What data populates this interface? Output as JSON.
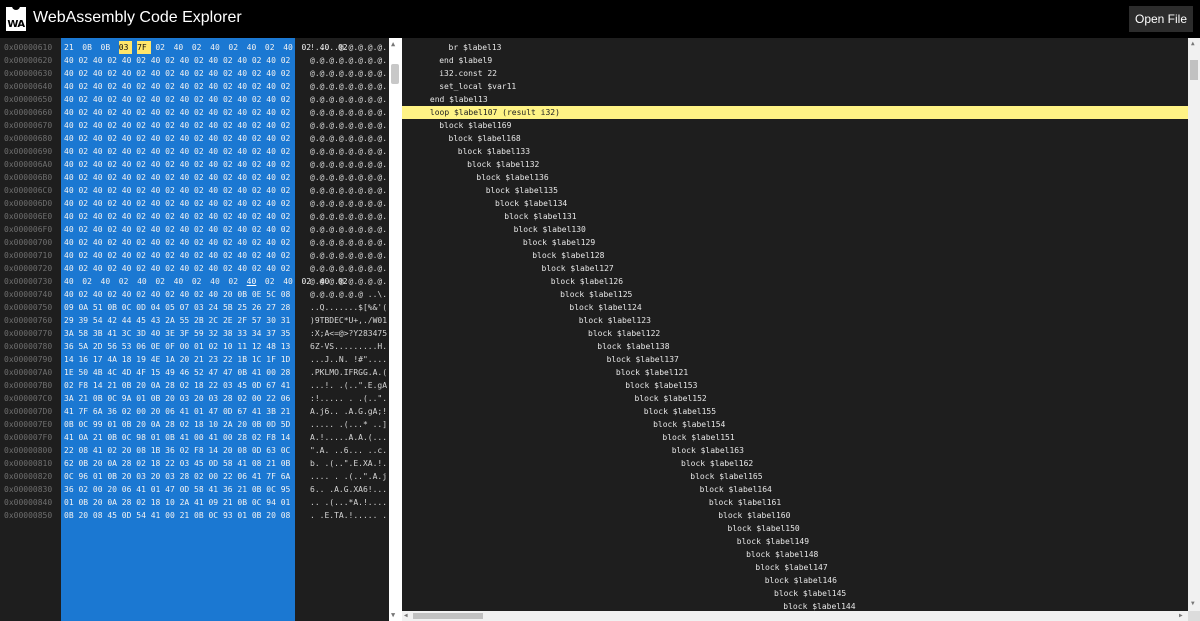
{
  "app": {
    "title": "WebAssembly Code Explorer",
    "logo_text": "WA",
    "open_button": "Open File"
  },
  "colors": {
    "header_bg": "#000000",
    "hex_highlight": "#1b78d2",
    "selected_byte": "#ffe66b",
    "code_highlight": "#fff385",
    "pane_bg": "#1e1e1e"
  },
  "icons": {
    "logo": "webassembly-logo-icon"
  },
  "hex_rows": [
    {
      "addr": "0x00000610",
      "bytes": "21 0B 0B 03 7F 02 40 02 40 02 40 02 40 02 40 02",
      "ascii": "!.....@.@.@.@.@."
    },
    {
      "addr": "0x00000620",
      "bytes": "40 02 40 02 40 02 40 02 40 02 40 02 40 02 40 02",
      "ascii": "@.@.@.@.@.@.@.@."
    },
    {
      "addr": "0x00000630",
      "bytes": "40 02 40 02 40 02 40 02 40 02 40 02 40 02 40 02",
      "ascii": "@.@.@.@.@.@.@.@."
    },
    {
      "addr": "0x00000640",
      "bytes": "40 02 40 02 40 02 40 02 40 02 40 02 40 02 40 02",
      "ascii": "@.@.@.@.@.@.@.@."
    },
    {
      "addr": "0x00000650",
      "bytes": "40 02 40 02 40 02 40 02 40 02 40 02 40 02 40 02",
      "ascii": "@.@.@.@.@.@.@.@."
    },
    {
      "addr": "0x00000660",
      "bytes": "40 02 40 02 40 02 40 02 40 02 40 02 40 02 40 02",
      "ascii": "@.@.@.@.@.@.@.@."
    },
    {
      "addr": "0x00000670",
      "bytes": "40 02 40 02 40 02 40 02 40 02 40 02 40 02 40 02",
      "ascii": "@.@.@.@.@.@.@.@."
    },
    {
      "addr": "0x00000680",
      "bytes": "40 02 40 02 40 02 40 02 40 02 40 02 40 02 40 02",
      "ascii": "@.@.@.@.@.@.@.@."
    },
    {
      "addr": "0x00000690",
      "bytes": "40 02 40 02 40 02 40 02 40 02 40 02 40 02 40 02",
      "ascii": "@.@.@.@.@.@.@.@."
    },
    {
      "addr": "0x000006A0",
      "bytes": "40 02 40 02 40 02 40 02 40 02 40 02 40 02 40 02",
      "ascii": "@.@.@.@.@.@.@.@."
    },
    {
      "addr": "0x000006B0",
      "bytes": "40 02 40 02 40 02 40 02 40 02 40 02 40 02 40 02",
      "ascii": "@.@.@.@.@.@.@.@."
    },
    {
      "addr": "0x000006C0",
      "bytes": "40 02 40 02 40 02 40 02 40 02 40 02 40 02 40 02",
      "ascii": "@.@.@.@.@.@.@.@."
    },
    {
      "addr": "0x000006D0",
      "bytes": "40 02 40 02 40 02 40 02 40 02 40 02 40 02 40 02",
      "ascii": "@.@.@.@.@.@.@.@."
    },
    {
      "addr": "0x000006E0",
      "bytes": "40 02 40 02 40 02 40 02 40 02 40 02 40 02 40 02",
      "ascii": "@.@.@.@.@.@.@.@."
    },
    {
      "addr": "0x000006F0",
      "bytes": "40 02 40 02 40 02 40 02 40 02 40 02 40 02 40 02",
      "ascii": "@.@.@.@.@.@.@.@."
    },
    {
      "addr": "0x00000700",
      "bytes": "40 02 40 02 40 02 40 02 40 02 40 02 40 02 40 02",
      "ascii": "@.@.@.@.@.@.@.@."
    },
    {
      "addr": "0x00000710",
      "bytes": "40 02 40 02 40 02 40 02 40 02 40 02 40 02 40 02",
      "ascii": "@.@.@.@.@.@.@.@."
    },
    {
      "addr": "0x00000720",
      "bytes": "40 02 40 02 40 02 40 02 40 02 40 02 40 02 40 02",
      "ascii": "@.@.@.@.@.@.@.@."
    },
    {
      "addr": "0x00000730",
      "bytes": "40 02 40 02 40 02 40 02 40 02 40 02 40 02 40 02",
      "ascii": "@.@.@.@.@.@.@.@."
    },
    {
      "addr": "0x00000740",
      "bytes": "40 02 40 02 40 02 40 02 40 02 40 20 0B 0E 5C 08",
      "ascii": "@.@.@.@.@.@ ..\\."
    },
    {
      "addr": "0x00000750",
      "bytes": "09 0A 51 0B 0C 0D 04 05 07 03 24 5B 25 26 27 28",
      "ascii": "..Q.......$[%&'("
    },
    {
      "addr": "0x00000760",
      "bytes": "29 39 54 42 44 45 43 2A 55 2B 2C 2E 2F 57 30 31",
      "ascii": ")9TBDEC*U+,./W01"
    },
    {
      "addr": "0x00000770",
      "bytes": "3A 58 3B 41 3C 3D 40 3E 3F 59 32 38 33 34 37 35",
      "ascii": ":X;A<=@>?Y283475"
    },
    {
      "addr": "0x00000780",
      "bytes": "36 5A 2D 56 53 06 0E 0F 00 01 02 10 11 12 48 13",
      "ascii": "6Z-VS.........H."
    },
    {
      "addr": "0x00000790",
      "bytes": "14 16 17 4A 18 19 4E 1A 20 21 23 22 1B 1C 1F 1D",
      "ascii": "...J..N. !#\"...."
    },
    {
      "addr": "0x000007A0",
      "bytes": "1E 50 4B 4C 4D 4F 15 49 46 52 47 47 0B 41 00 28",
      "ascii": ".PKLMO.IFRGG.A.("
    },
    {
      "addr": "0x000007B0",
      "bytes": "02 F8 14 21 0B 20 0A 28 02 18 22 03 45 0D 67 41",
      "ascii": "...!. .(..\".E.gA"
    },
    {
      "addr": "0x000007C0",
      "bytes": "3A 21 0B 0C 9A 01 0B 20 03 20 03 28 02 00 22 06",
      "ascii": ":!..... . .(..\"."
    },
    {
      "addr": "0x000007D0",
      "bytes": "41 7F 6A 36 02 00 20 06 41 01 47 0D 67 41 3B 21",
      "ascii": "A.j6.. .A.G.gA;!"
    },
    {
      "addr": "0x000007E0",
      "bytes": "0B 0C 99 01 0B 20 0A 28 02 18 10 2A 20 0B 0D 5D",
      "ascii": "..... .(...* ..]"
    },
    {
      "addr": "0x000007F0",
      "bytes": "41 0A 21 0B 0C 98 01 0B 41 00 41 00 28 02 F8 14",
      "ascii": "A.!.....A.A.(..."
    },
    {
      "addr": "0x00000800",
      "bytes": "22 08 41 02 20 08 1B 36 02 F8 14 20 08 0D 63 0C",
      "ascii": "\".A. ..6... ..c."
    },
    {
      "addr": "0x00000810",
      "bytes": "62 0B 20 0A 28 02 18 22 03 45 0D 58 41 08 21 0B",
      "ascii": "b. .(..\".E.XA.!."
    },
    {
      "addr": "0x00000820",
      "bytes": "0C 96 01 0B 20 03 20 03 28 02 00 22 06 41 7F 6A",
      "ascii": ".... . .(..\".A.j"
    },
    {
      "addr": "0x00000830",
      "bytes": "36 02 00 20 06 41 01 47 0D 58 41 36 21 0B 0C 95",
      "ascii": "6.. .A.G.XA6!..."
    },
    {
      "addr": "0x00000840",
      "bytes": "01 0B 20 0A 28 02 18 10 2A 41 09 21 0B 0C 94 01",
      "ascii": ".. .(...*A.!...."
    },
    {
      "addr": "0x00000850",
      "bytes": "0B 20 08 45 0D 54 41 00 21 0B 0C 93 01 0B 20 08",
      "ascii": ". .E.TA.!..... ."
    }
  ],
  "code_lines": [
    {
      "indent": 5,
      "text": "br $label13"
    },
    {
      "indent": 4,
      "text": "end $label9"
    },
    {
      "indent": 4,
      "text": "i32.const 22"
    },
    {
      "indent": 4,
      "text": "set_local $var11"
    },
    {
      "indent": 3,
      "text": "end $label13"
    },
    {
      "indent": 3,
      "text": "loop $label107 (result i32)"
    },
    {
      "indent": 4,
      "text": "block $label169"
    },
    {
      "indent": 5,
      "text": "block $label168"
    },
    {
      "indent": 6,
      "text": "block $label133"
    },
    {
      "indent": 7,
      "text": "block $label132"
    },
    {
      "indent": 8,
      "text": "block $label136"
    },
    {
      "indent": 9,
      "text": "block $label135"
    },
    {
      "indent": 10,
      "text": "block $label134"
    },
    {
      "indent": 11,
      "text": "block $label131"
    },
    {
      "indent": 12,
      "text": "block $label130"
    },
    {
      "indent": 13,
      "text": "block $label129"
    },
    {
      "indent": 14,
      "text": "block $label128"
    },
    {
      "indent": 15,
      "text": "block $label127"
    },
    {
      "indent": 16,
      "text": "block $label126"
    },
    {
      "indent": 17,
      "text": "block $label125"
    },
    {
      "indent": 18,
      "text": "block $label124"
    },
    {
      "indent": 19,
      "text": "block $label123"
    },
    {
      "indent": 20,
      "text": "block $label122"
    },
    {
      "indent": 21,
      "text": "block $label138"
    },
    {
      "indent": 22,
      "text": "block $label137"
    },
    {
      "indent": 23,
      "text": "block $label121"
    },
    {
      "indent": 24,
      "text": "block $label153"
    },
    {
      "indent": 25,
      "text": "block $label152"
    },
    {
      "indent": 26,
      "text": "block $label155"
    },
    {
      "indent": 27,
      "text": "block $label154"
    },
    {
      "indent": 28,
      "text": "block $label151"
    },
    {
      "indent": 29,
      "text": "block $label163"
    },
    {
      "indent": 30,
      "text": "block $label162"
    },
    {
      "indent": 31,
      "text": "block $label165"
    },
    {
      "indent": 32,
      "text": "block $label164"
    },
    {
      "indent": 33,
      "text": "block $label161"
    },
    {
      "indent": 34,
      "text": "block $label160"
    },
    {
      "indent": 35,
      "text": "block $label150"
    },
    {
      "indent": 36,
      "text": "block $label149"
    },
    {
      "indent": 37,
      "text": "block $label148"
    },
    {
      "indent": 38,
      "text": "block $label147"
    },
    {
      "indent": 39,
      "text": "block $label146"
    },
    {
      "indent": 40,
      "text": "block $label145"
    },
    {
      "indent": 41,
      "text": "block $label144"
    }
  ],
  "highlighted_code_line": 5
}
